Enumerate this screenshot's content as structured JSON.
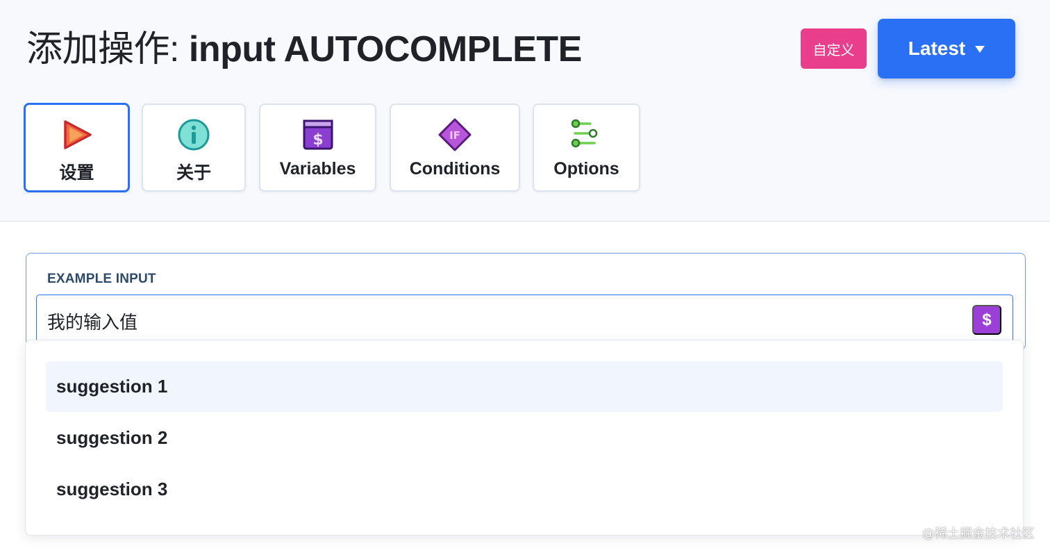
{
  "header": {
    "title_prefix": "添加操作: ",
    "title_action": "input AUTOCOMPLETE",
    "custom_button": "自定义",
    "version_button": "Latest"
  },
  "tabs": [
    {
      "label": "设置",
      "icon": "play-icon",
      "active": true
    },
    {
      "label": "关于",
      "icon": "info-icon",
      "active": false
    },
    {
      "label": "Variables",
      "icon": "dollar-icon",
      "active": false
    },
    {
      "label": "Conditions",
      "icon": "if-diamond-icon",
      "active": false
    },
    {
      "label": "Options",
      "icon": "sliders-icon",
      "active": false
    }
  ],
  "form": {
    "field_label": "EXAMPLE INPUT",
    "input_value": "我的输入值",
    "variable_button": "$"
  },
  "suggestions": [
    "suggestion 1",
    "suggestion 2",
    "suggestion 3"
  ],
  "watermark": "@稀土掘金技术社区",
  "colors": {
    "primary": "#2a70f5",
    "custom_button": "#e83e8c",
    "variable_button": "#9b3fd6"
  }
}
